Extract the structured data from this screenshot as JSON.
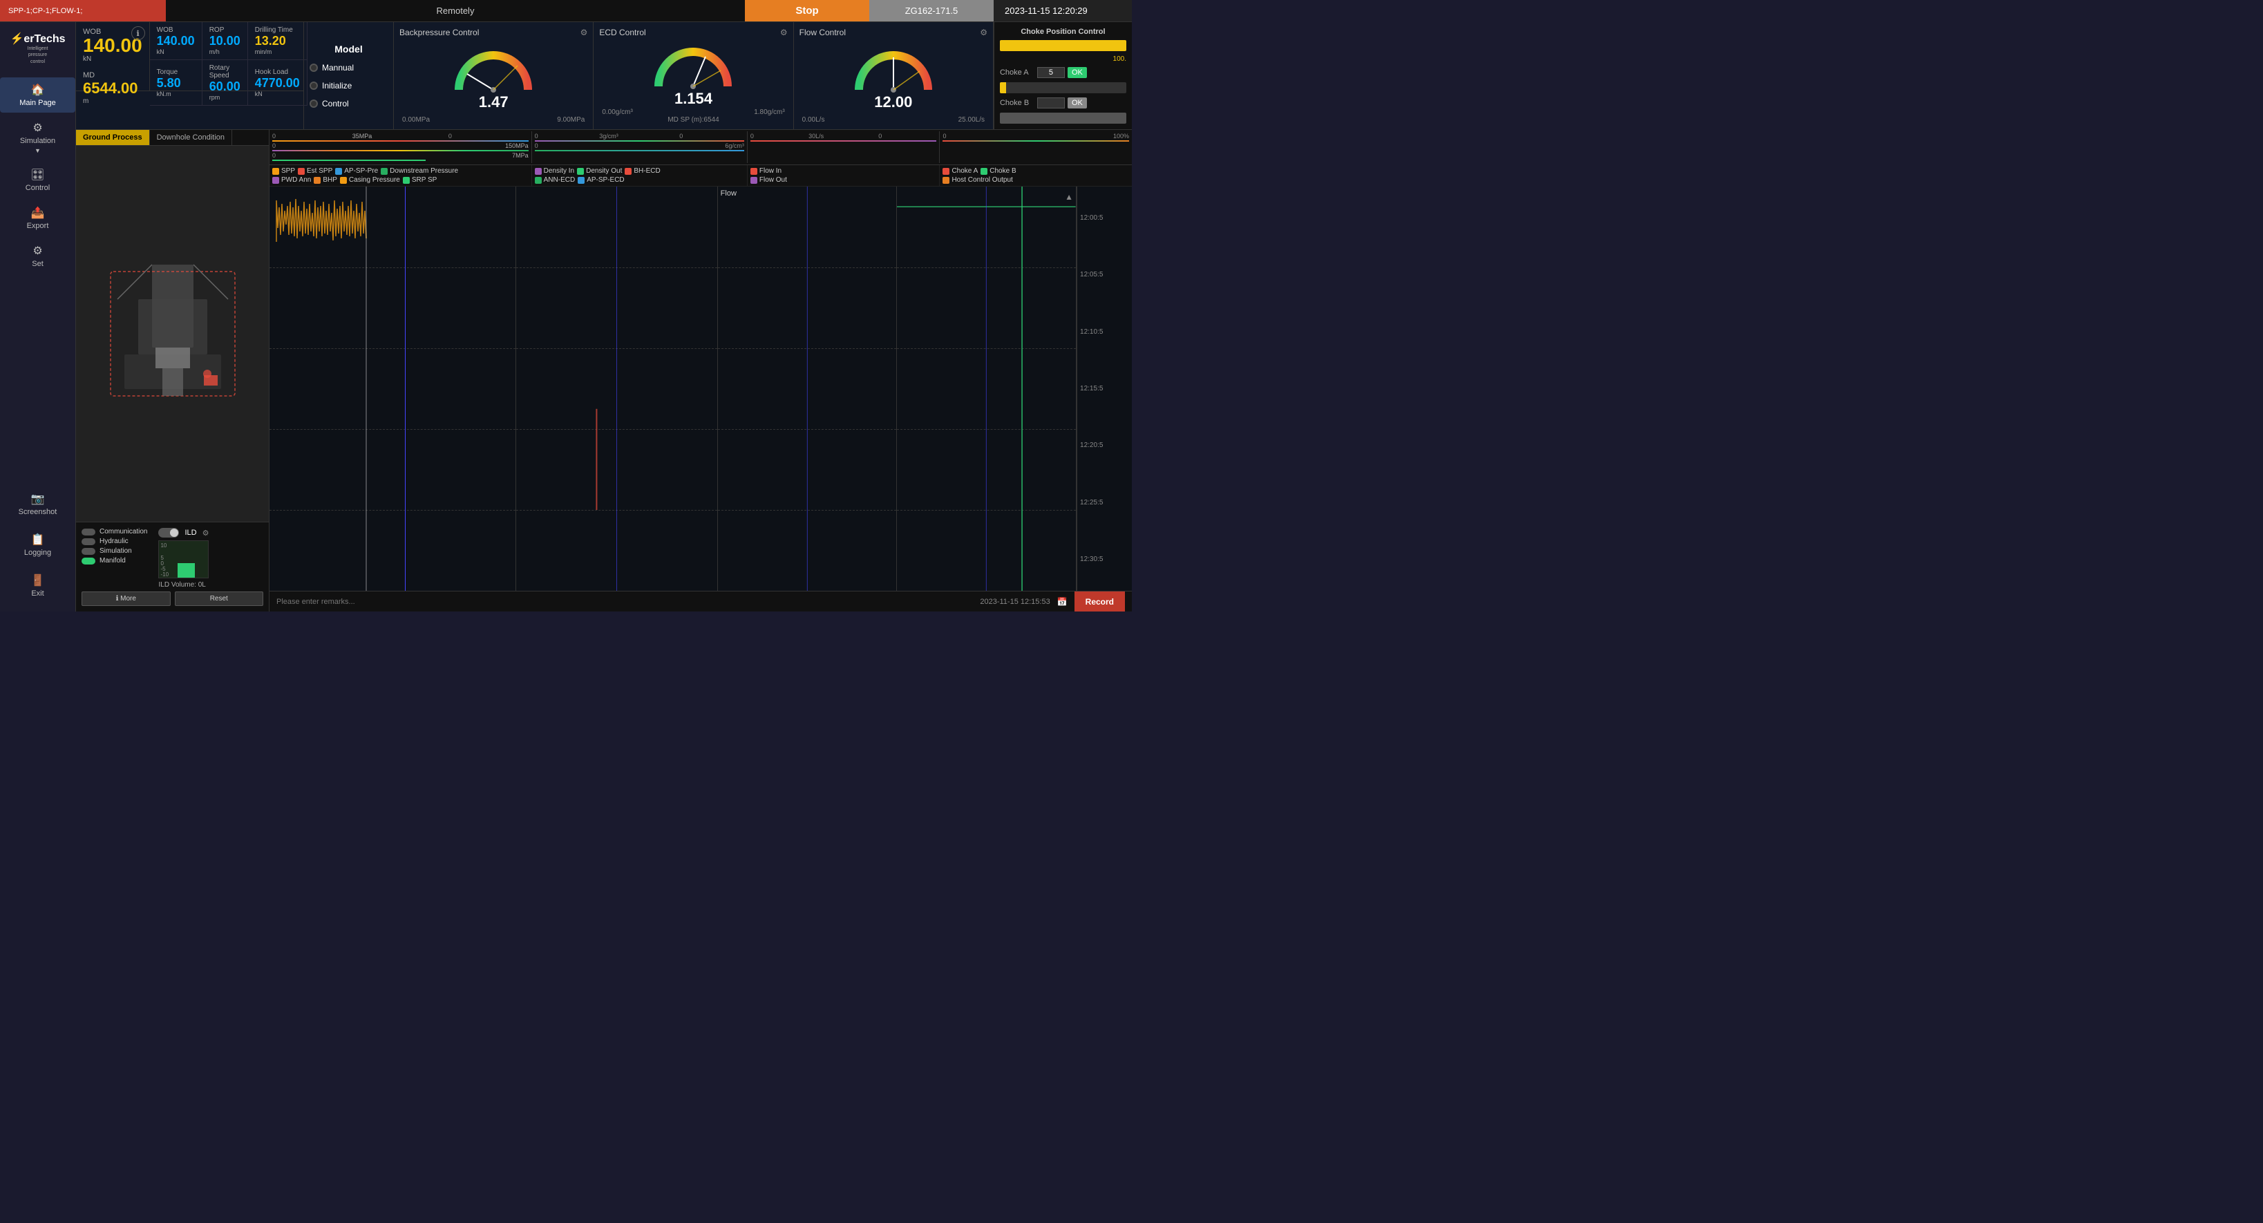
{
  "header": {
    "spp_label": "SPP-1;CP-1;FLOW-1;",
    "remotely_label": "Remotely",
    "stop_label": "Stop",
    "zg_label": "ZG162-171.5",
    "datetime": "2023-11-15 12:20:29"
  },
  "sidebar": {
    "items": [
      {
        "id": "main-page",
        "label": "Main Page",
        "icon": "🏠",
        "active": true
      },
      {
        "id": "simulation",
        "label": "Simulation",
        "icon": "⚙",
        "active": false
      },
      {
        "id": "control",
        "label": "Control",
        "icon": "🎛",
        "active": false
      },
      {
        "id": "export",
        "label": "Export",
        "icon": "📤",
        "active": false
      },
      {
        "id": "set",
        "label": "Set",
        "icon": "⚙",
        "active": false
      }
    ],
    "bottom": [
      {
        "id": "screenshot",
        "label": "Screenshot",
        "icon": "📷"
      },
      {
        "id": "logging",
        "label": "Logging",
        "icon": "📋"
      },
      {
        "id": "exit",
        "label": "Exit",
        "icon": "🚪"
      }
    ]
  },
  "metrics": {
    "wob_label": "WOB",
    "wob_value": "140.00",
    "wob_unit": "kN",
    "md_label": "MD",
    "md_value": "6544.00",
    "md_unit": "m",
    "cells": [
      {
        "label": "WOB",
        "value": "140.00",
        "unit": "kN"
      },
      {
        "label": "ROP",
        "value": "10.00",
        "unit": "m/h"
      },
      {
        "label": "Drilling Time",
        "value": "13.20",
        "unit": "min/m"
      },
      {
        "label": "Torque",
        "value": "5.80",
        "unit": "kN.m"
      },
      {
        "label": "Rotary Speed",
        "value": "60.00",
        "unit": "rpm"
      },
      {
        "label": "Hook Load",
        "value": "4770.00",
        "unit": "kN"
      }
    ]
  },
  "model": {
    "title": "Model",
    "options": [
      {
        "label": "Mannual",
        "active": false
      },
      {
        "label": "Initialize",
        "active": false
      },
      {
        "label": "Control",
        "active": false
      }
    ]
  },
  "gauges": [
    {
      "title": "Backpressure Control",
      "value": "1.47",
      "range_min": "0.00MPa",
      "range_max": "9.00MPa",
      "arc_color": "#e74c3c",
      "needle_pct": 16
    },
    {
      "title": "ECD Control",
      "value": "1.154",
      "range_min": "0.00g/cm³",
      "range_max": "1.80g/cm³",
      "extra": "MD SP (m):6544",
      "arc_color": "#e67e22",
      "needle_pct": 64
    },
    {
      "title": "Flow Control",
      "value": "12.00",
      "range_min": "0.00L/s",
      "range_max": "25.00L/s",
      "arc_color": "#e74c3c",
      "needle_pct": 48
    }
  ],
  "choke": {
    "title": "Choke Position Control",
    "bar_value": 100,
    "choke_a_label": "Choke A",
    "choke_a_value": "5",
    "choke_b_label": "Choke B",
    "choke_b_value": "",
    "ok_label": "OK",
    "pct_100": "100."
  },
  "ground_process": {
    "tab_active": "Ground Process",
    "tab_other": "Downhole Condition",
    "comm_items": [
      {
        "label": "Communication",
        "color": "gray"
      },
      {
        "label": "Hydraulic",
        "color": "gray"
      },
      {
        "label": "Simulation",
        "color": "gray"
      },
      {
        "label": "Manifold",
        "color": "green"
      }
    ],
    "ild_label": "ILD",
    "ild_volume_label": "ILD Volume:",
    "ild_volume_value": "0L",
    "reset_btn": "Reset",
    "more_btn": "More"
  },
  "chart_scales": [
    {
      "min": "0",
      "max": "35MPa",
      "min2": "0",
      "max2": "150MPa",
      "min3": "0",
      "max3": "7MPa"
    },
    {
      "min": "0",
      "max": "3g/cm³",
      "min2": "0",
      "max2": "6g/cm³"
    },
    {
      "min": "0",
      "max": "30L/s",
      "min3": "0",
      "max3": "100%"
    }
  ],
  "legends": {
    "section1": [
      {
        "label": "SPP",
        "color": "#f39c12"
      },
      {
        "label": "Est SPP",
        "color": "#e74c3c"
      },
      {
        "label": "AP-SP-Pre",
        "color": "#3498db"
      },
      {
        "label": "Downstream Pressure",
        "color": "#27ae60"
      },
      {
        "label": "PWD Ann",
        "color": "#9b59b6"
      },
      {
        "label": "BHP",
        "color": "#e67e22"
      },
      {
        "label": "Casing Pressure",
        "color": "#f39c12"
      },
      {
        "label": "SRP SP",
        "color": "#2ecc71"
      }
    ],
    "section2": [
      {
        "label": "Density In",
        "color": "#9b59b6"
      },
      {
        "label": "Density Out",
        "color": "#2ecc71"
      },
      {
        "label": "BH-ECD",
        "color": "#e74c3c"
      },
      {
        "label": "ANN-ECD",
        "color": "#27ae60"
      },
      {
        "label": "AP-SP-ECD",
        "color": "#3498db"
      }
    ],
    "section3": [
      {
        "label": "Flow In",
        "color": "#e74c3c"
      },
      {
        "label": "Flow Out",
        "color": "#9b59b6"
      }
    ],
    "section4": [
      {
        "label": "Choke A",
        "color": "#e74c3c"
      },
      {
        "label": "Choke B",
        "color": "#2ecc71"
      },
      {
        "label": "Host Control Output",
        "color": "#e67e22"
      }
    ]
  },
  "time_labels": [
    "12:00:5",
    "12:05:5",
    "12:10:5",
    "12:15:5",
    "12:20:5",
    "12:25:5",
    "12:30:5"
  ],
  "status_bar": {
    "remarks_placeholder": "Please enter remarks...",
    "datetime": "2023-11-15 12:15:53",
    "record_label": "Record"
  },
  "flow_label": "Flow"
}
